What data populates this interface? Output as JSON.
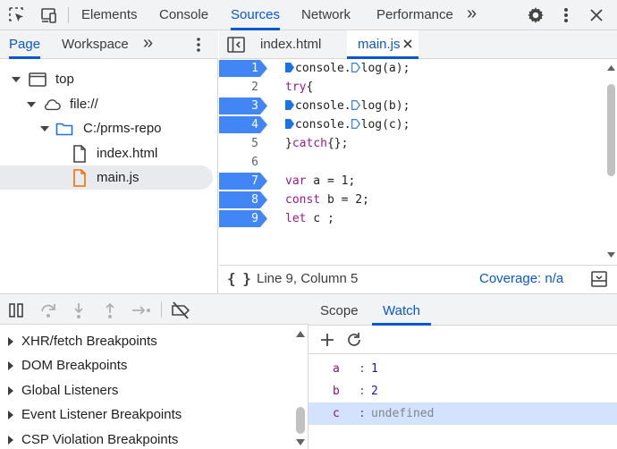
{
  "toolbar": {
    "tabs": [
      "Elements",
      "Console",
      "Sources",
      "Network",
      "Performance"
    ],
    "active_tab": "Sources",
    "more": "»"
  },
  "navigator": {
    "tabs": [
      "Page",
      "Workspace"
    ],
    "active_tab": "Page",
    "more": "»",
    "tree": [
      {
        "label": "top",
        "icon": "frame-icon"
      },
      {
        "label": "file://",
        "icon": "cloud-icon"
      },
      {
        "label": "C:/prms-repo",
        "icon": "folder-icon"
      },
      {
        "label": "index.html",
        "icon": "document-icon"
      },
      {
        "label": "main.js",
        "icon": "script-file-icon",
        "selected": true
      }
    ]
  },
  "editor": {
    "tabs": [
      {
        "label": "index.html",
        "active": false
      },
      {
        "label": "main.js",
        "active": true,
        "closable": true
      }
    ],
    "lines": [
      {
        "n": "1",
        "bp": true
      },
      {
        "n": "2",
        "bp": false
      },
      {
        "n": "3",
        "bp": true
      },
      {
        "n": "4",
        "bp": true
      },
      {
        "n": "5",
        "bp": false
      },
      {
        "n": "6",
        "bp": false
      },
      {
        "n": "7",
        "bp": true
      },
      {
        "n": "8",
        "bp": true
      },
      {
        "n": "9",
        "bp": true
      }
    ],
    "code": {
      "console": "console.",
      "log_a": "log(a);",
      "log_b": "log(b);",
      "log_c": "log(c);",
      "try": "try",
      "brace_open": "{",
      "catch_close": "}",
      "catch_kw": "catch",
      "catch_rest": "{};",
      "var": "var",
      "var_rest": " a = 1;",
      "const": "const",
      "const_rest": " b = 2;",
      "let": "let",
      "let_rest": " c ;"
    },
    "status": {
      "braces": "{ }",
      "position": "Line 9, Column 5",
      "coverage": "Coverage: n/a"
    }
  },
  "breakpoints": {
    "sections": [
      "XHR/fetch Breakpoints",
      "DOM Breakpoints",
      "Global Listeners",
      "Event Listener Breakpoints",
      "CSP Violation Breakpoints"
    ]
  },
  "watch": {
    "tabs": [
      "Scope",
      "Watch"
    ],
    "active_tab": "Watch",
    "items": [
      {
        "name": "a",
        "value": "1"
      },
      {
        "name": "b",
        "value": "2"
      },
      {
        "name": "c",
        "value": "undefined"
      }
    ]
  },
  "colors": {
    "accent": "#0b57d0",
    "breakpoint": "#4285f4",
    "keyword": "#9a1b8a",
    "selection": "#d3e3fd"
  }
}
